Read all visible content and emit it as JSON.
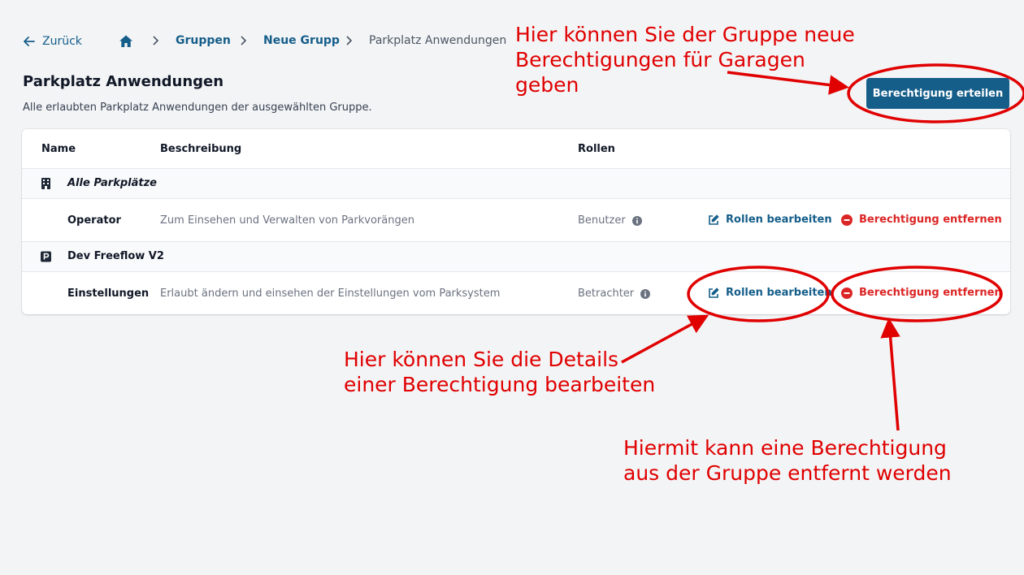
{
  "breadcrumb": {
    "back_label": "Zurück",
    "items": [
      "Gruppen",
      "Neue Grupp"
    ],
    "current": "Parkplatz Anwendungen"
  },
  "page": {
    "title": "Parkplatz Anwendungen",
    "subtitle": "Alle erlaubten Parkplatz Anwendungen der ausgewählten Gruppe.",
    "primary_button": "Berechtigung erteilen"
  },
  "table": {
    "headers": {
      "name": "Name",
      "description": "Beschreibung",
      "roles": "Rollen"
    },
    "groups": [
      {
        "name": "Alle Parkplätze",
        "icon": "building-icon",
        "rows": [
          {
            "name": "Operator",
            "description": "Zum Einsehen und Verwalten von Parkvorängen",
            "role": "Benutzer",
            "edit": "Rollen bearbeiten",
            "remove": "Berechtigung entfernen"
          }
        ]
      },
      {
        "name": "Dev Freeflow V2",
        "icon": "parking-icon",
        "rows": [
          {
            "name": "Einstellungen",
            "description": "Erlaubt ändern und einsehen der Einstellungen vom Parksystem",
            "role": "Betrachter",
            "edit": "Rollen bearbeiten",
            "remove": "Berechtigung entfernen"
          }
        ]
      }
    ]
  },
  "annotations": {
    "grant": [
      "Hier können Sie der Gruppe neue",
      "Berechtigungen für Garagen",
      "geben"
    ],
    "edit": [
      "Hier können Sie die Details",
      "einer Berechtigung bearbeiten"
    ],
    "remove": [
      "Hiermit kann eine Berechtigung",
      "aus der Gruppe entfernt werden"
    ]
  },
  "colors": {
    "primary": "#155e8a",
    "danger": "#dc2626",
    "annotation": "#e00000",
    "background": "#f3f4f6"
  }
}
